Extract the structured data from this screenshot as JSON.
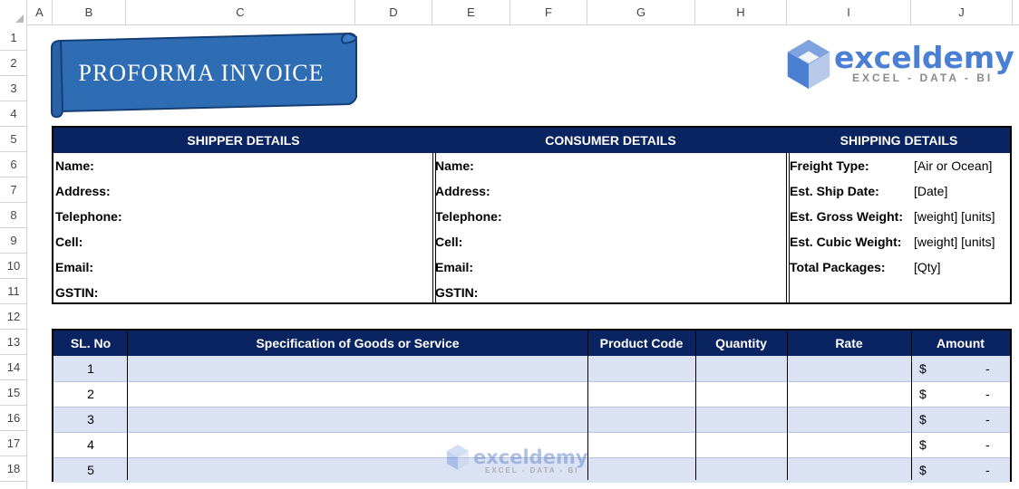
{
  "columns": [
    "A",
    "B",
    "C",
    "D",
    "E",
    "F",
    "G",
    "H",
    "I",
    "J"
  ],
  "rows": [
    "1",
    "2",
    "3",
    "4",
    "5",
    "6",
    "7",
    "8",
    "9",
    "10",
    "11",
    "12",
    "13",
    "14",
    "15",
    "16",
    "17",
    "18"
  ],
  "banner": {
    "title": "PROFORMA INVOICE",
    "color": "#2e6db4"
  },
  "logo": {
    "word": "exceldemy",
    "tagline": "EXCEL - DATA - BI"
  },
  "watermark": {
    "word": "exceldemy",
    "tagline": "EXCEL - DATA - BI"
  },
  "shipper": {
    "header": "SHIPPER DETAILS",
    "fields": [
      "Name:",
      "Address:",
      "Telephone:",
      "Cell:",
      "Email:",
      "GSTIN:"
    ]
  },
  "consumer": {
    "header": "CONSUMER DETAILS",
    "fields": [
      "Name:",
      "Address:",
      "Telephone:",
      "Cell:",
      "Email:",
      "GSTIN:"
    ]
  },
  "shipping": {
    "header": "SHIPPING DETAILS",
    "fields": [
      {
        "label": "Freight Type:",
        "value": "[Air or Ocean]"
      },
      {
        "label": "Est. Ship Date:",
        "value": "[Date]"
      },
      {
        "label": "Est. Gross Weight:",
        "value": "[weight] [units]"
      },
      {
        "label": "Est. Cubic Weight:",
        "value": "[weight] [units]"
      },
      {
        "label": "Total Packages:",
        "value": "[Qty]"
      }
    ]
  },
  "items": {
    "headers": {
      "sl": "SL. No",
      "spec": "Specification of Goods or Service",
      "code": "Product Code",
      "qty": "Quantity",
      "rate": "Rate",
      "amount": "Amount"
    },
    "rows": [
      {
        "sl": "1",
        "currency": "$",
        "amount": "-"
      },
      {
        "sl": "2",
        "currency": "$",
        "amount": "-"
      },
      {
        "sl": "3",
        "currency": "$",
        "amount": "-"
      },
      {
        "sl": "4",
        "currency": "$",
        "amount": "-"
      },
      {
        "sl": "5",
        "currency": "$",
        "amount": "-"
      }
    ]
  },
  "colors": {
    "header_bg": "#0a2461",
    "alt_row": "#dbe2f4",
    "logo": "#4a7fd4"
  }
}
